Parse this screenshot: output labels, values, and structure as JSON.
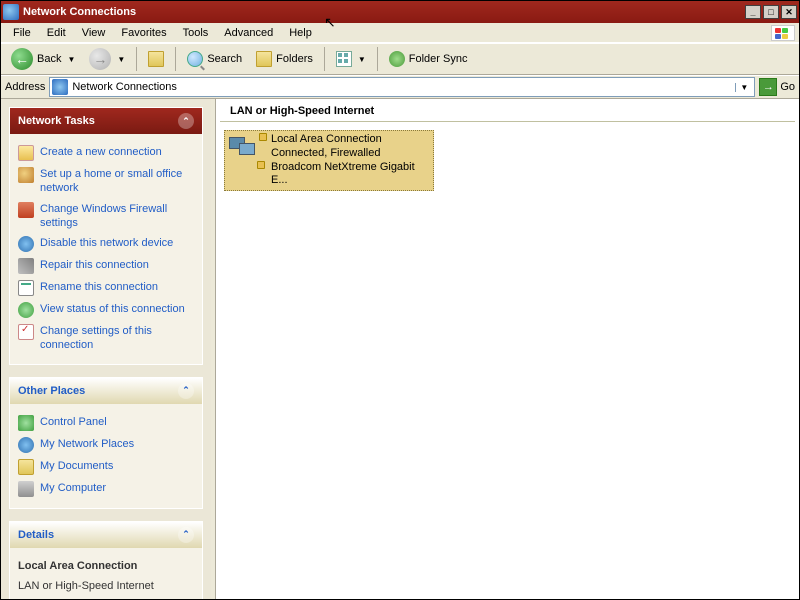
{
  "window": {
    "title": "Network Connections"
  },
  "menu": {
    "file": "File",
    "edit": "Edit",
    "view": "View",
    "favorites": "Favorites",
    "tools": "Tools",
    "advanced": "Advanced",
    "help": "Help"
  },
  "toolbar": {
    "back": "Back",
    "search": "Search",
    "folders": "Folders",
    "folder_sync": "Folder Sync"
  },
  "address": {
    "label": "Address",
    "value": "Network Connections",
    "go": "Go"
  },
  "sidebar": {
    "network_tasks": {
      "title": "Network Tasks",
      "items": [
        "Create a new connection",
        "Set up a home or small office network",
        "Change Windows Firewall settings",
        "Disable this network device",
        "Repair this connection",
        "Rename this connection",
        "View status of this connection",
        "Change settings of this connection"
      ]
    },
    "other_places": {
      "title": "Other Places",
      "items": [
        "Control Panel",
        "My Network Places",
        "My Documents",
        "My Computer"
      ]
    },
    "details": {
      "title": "Details",
      "name": "Local Area Connection",
      "type": "LAN or High-Speed Internet"
    }
  },
  "main": {
    "group": "LAN or High-Speed Internet",
    "connection": {
      "name": "Local Area Connection",
      "status": "Connected, Firewalled",
      "device": "Broadcom NetXtreme Gigabit E..."
    }
  }
}
